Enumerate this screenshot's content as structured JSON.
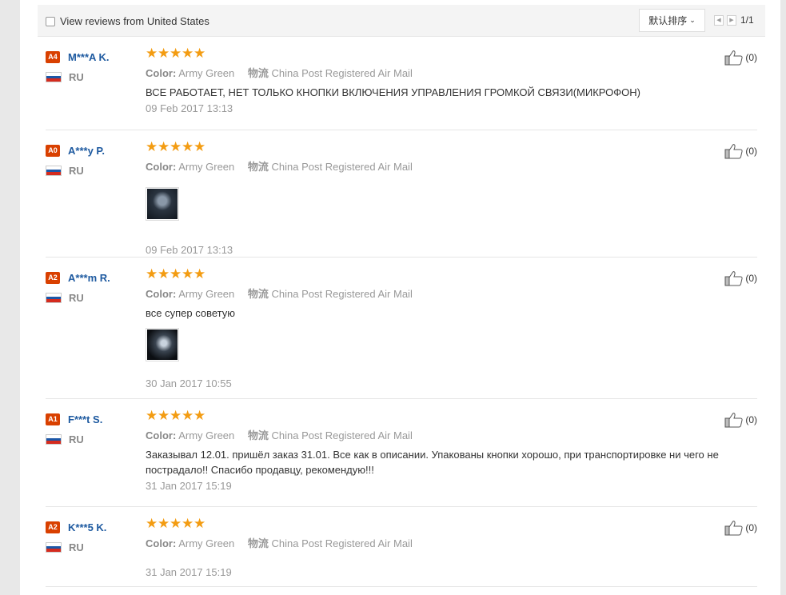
{
  "toolbar": {
    "filter_label": "View reviews from United States",
    "sort_label": "默认排序",
    "page_text": "1/1"
  },
  "reviews": [
    {
      "level": "A4",
      "name": "M***A K.",
      "country": "RU",
      "rating": 5,
      "color_key": "Color:",
      "color_value": "Army Green",
      "ship_key": "物流",
      "ship_value": "China Post Registered Air Mail",
      "text": "ВСЕ РАБОТАЕТ, НЕТ ТОЛЬКО КНОПКИ ВКЛЮЧЕНИЯ УПРАВЛЕНИЯ ГРОМКОЙ СВЯЗИ(МИКРОФОН)",
      "has_photo": false,
      "date": "09 Feb 2017 13:13",
      "likes": "(0)"
    },
    {
      "level": "A0",
      "name": "A***y P.",
      "country": "RU",
      "rating": 5,
      "color_key": "Color:",
      "color_value": "Army Green",
      "ship_key": "物流",
      "ship_value": "China Post Registered Air Mail",
      "text": "",
      "has_photo": true,
      "date": "09 Feb 2017 13:13",
      "likes": "(0)"
    },
    {
      "level": "A2",
      "name": "A***m R.",
      "country": "RU",
      "rating": 5,
      "color_key": "Color:",
      "color_value": "Army Green",
      "ship_key": "物流",
      "ship_value": "China Post Registered Air Mail",
      "text": "все супер советую",
      "has_photo": true,
      "date": "30 Jan 2017 10:55",
      "likes": "(0)"
    },
    {
      "level": "A1",
      "name": "F***t S.",
      "country": "RU",
      "rating": 5,
      "color_key": "Color:",
      "color_value": "Army Green",
      "ship_key": "物流",
      "ship_value": "China Post Registered Air Mail",
      "text": "Заказывал 12.01. пришёл заказ 31.01. Все как в описании. Упакованы кнопки хорошо, при транспортировке ни чего не пострадало!! Спасибо продавцу, рекомендую!!!",
      "has_photo": false,
      "date": "31 Jan 2017 15:19",
      "likes": "(0)"
    },
    {
      "level": "A2",
      "name": "K***5 K.",
      "country": "RU",
      "rating": 5,
      "color_key": "Color:",
      "color_value": "Army Green",
      "ship_key": "物流",
      "ship_value": "China Post Registered Air Mail",
      "text": "",
      "has_photo": false,
      "date": "31 Jan 2017 15:19",
      "likes": "(0)"
    }
  ],
  "colors": {
    "level_badge": "#d94000",
    "username": "#1e5aa0",
    "star": "#f39c12"
  },
  "icons": {
    "like": "thumbs-up-icon",
    "flag": "russia-flag-icon"
  }
}
